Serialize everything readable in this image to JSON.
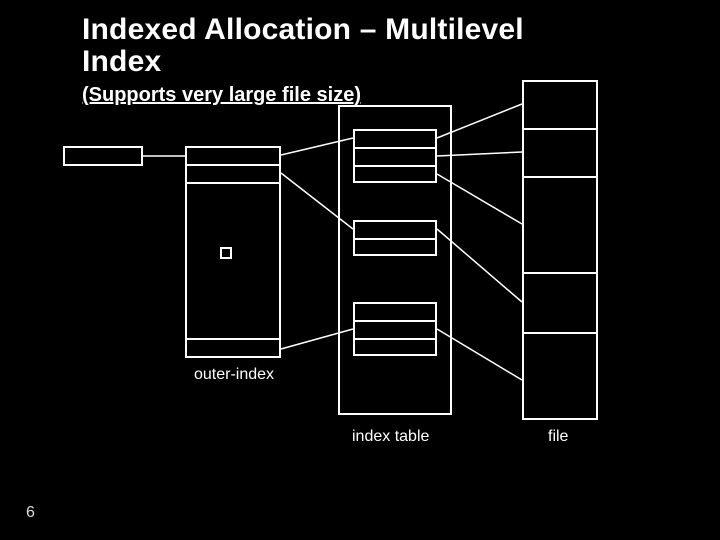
{
  "title_line1": "Indexed Allocation – Multilevel",
  "title_line2": "Index",
  "subtitle": "(Supports very large file size)",
  "labels": {
    "outer_index": "outer-index",
    "index_table": "index table",
    "file": "file"
  },
  "page_number": "6"
}
